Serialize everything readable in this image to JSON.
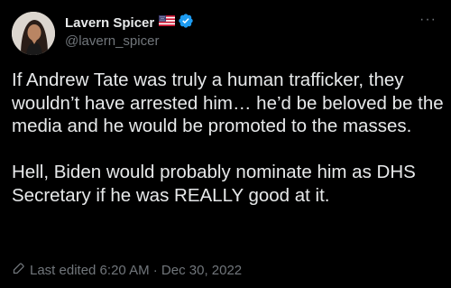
{
  "author": {
    "display_name": "Lavern Spicer",
    "handle": "@lavern_spicer",
    "flag_icon": "us-flag-icon",
    "verified_icon": "verified-badge-icon",
    "verified_color": "#1d9bf0"
  },
  "more_label": "···",
  "tweet": {
    "paragraphs": [
      "If Andrew Tate was truly a human trafficker, they wouldn’t have arrested him… he’d be beloved be the media and he would be promoted to the masses.",
      "Hell, Biden would probably nominate him as DHS Secretary if he was REALLY good at it."
    ],
    "edited_label": "Last edited 6:20 AM · Dec 30, 2022"
  },
  "colors": {
    "background": "#000000",
    "primary_text": "#e7e9ea",
    "secondary_text": "#71767b"
  }
}
